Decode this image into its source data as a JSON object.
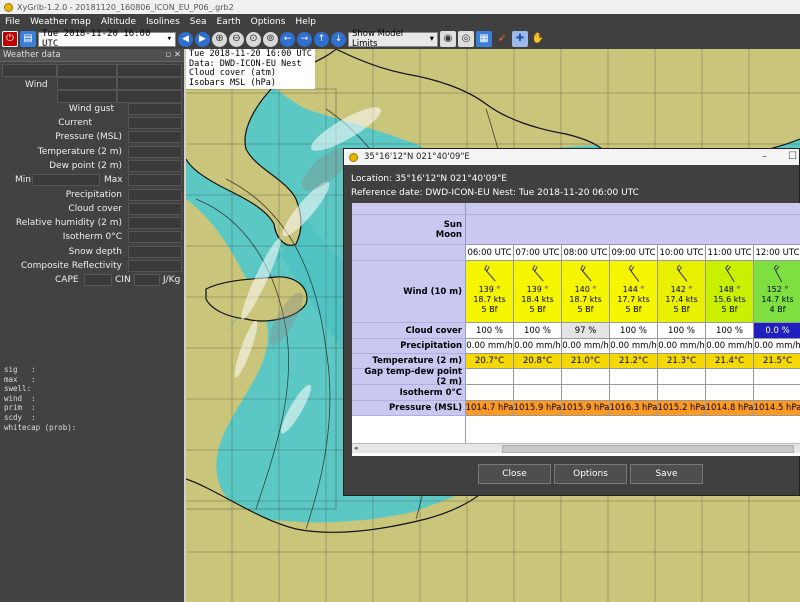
{
  "window": {
    "title": "XyGrib-1.2.0 - 20181120_160806_ICON_EU_P06_.grb2"
  },
  "menu": [
    "File",
    "Weather map",
    "Altitude",
    "Isolines",
    "Sea",
    "Earth",
    "Options",
    "Help"
  ],
  "toolbar": {
    "date_value": "Tue 2018-11-20 16:00 UTC",
    "limits_value": "Show Model Limits",
    "icons": [
      "power-icon",
      "open-file-icon",
      "prev-icon",
      "next-icon",
      "zoom-icons",
      "nav-icons",
      "globe-icons",
      "rocket-icon",
      "crosshair-icon",
      "hand-icon"
    ]
  },
  "panel": {
    "title": "Weather data",
    "wind": "Wind",
    "wind_gust": "Wind gust",
    "current": "Current",
    "pressure": "Pressure (MSL)",
    "temperature": "Temperature (2 m)",
    "dew_point": "Dew point (2 m)",
    "min": "Min",
    "max": "Max",
    "precipitation": "Precipitation",
    "cloud_cover": "Cloud cover",
    "humidity": "Relative humidity (2 m)",
    "isotherm": "Isotherm 0°C",
    "snow_depth": "Snow depth",
    "reflectivity": "Composite Reflectivity",
    "cape": "CAPE",
    "cin": "CIN",
    "jkg": "J/Kg",
    "text_info": "sig   :\nmax   :\nswell:\nwind  :\nprim  :\nscdy  :\nwhitecap (prob):"
  },
  "map_info": {
    "line1": "Tue 2018-11-20 16:00 UTC",
    "line2": "Data: DWD-ICON-EU Nest",
    "line3": "Cloud cover (atm)",
    "line4": "Isobars MSL (hPa)"
  },
  "dialog": {
    "title": "35°16'12\"N 021°40'09\"E",
    "location": "Location:  35°16'12\"N  021°40'09\"E",
    "reference": "Reference date: DWD-ICON-EU Nest: Tue 2018-11-20 06:00 UTC",
    "row_labels": {
      "sun": "Sun",
      "moon": "Moon",
      "wind": "Wind (10 m)",
      "cloud": "Cloud cover",
      "precip": "Precipitation",
      "temp": "Temperature (2 m)",
      "gap": "Gap temp-dew point (2 m)",
      "isotherm": "Isotherm 0°C",
      "pressure": "Pressure (MSL)"
    },
    "times": [
      "06:00 UTC",
      "07:00 UTC",
      "08:00 UTC",
      "09:00 UTC",
      "10:00 UTC",
      "11:00 UTC",
      "12:00 UTC"
    ],
    "wind_dir": [
      "139 °",
      "139 °",
      "140 °",
      "144 °",
      "142 °",
      "148 °",
      "152 °"
    ],
    "wind_kts": [
      "18.7  kts",
      "18.4  kts",
      "18.7  kts",
      "17.7  kts",
      "17.4  kts",
      "15.6  kts",
      "14.7  kts"
    ],
    "wind_bf": [
      "5 Bf",
      "5 Bf",
      "5 Bf",
      "5 Bf",
      "5 Bf",
      "5 Bf",
      "4 Bf"
    ],
    "wind_colors": [
      "#f5f500",
      "#f5f500",
      "#f5f500",
      "#f5f500",
      "#e8f000",
      "#c8f000",
      "#7ee040"
    ],
    "cloud": [
      "100 %",
      "100 %",
      "97 %",
      "100 %",
      "100 %",
      "100 %",
      "0.0 %"
    ],
    "cloud_colors": [
      "#ffffff",
      "#ffffff",
      "#e4e4e4",
      "#ffffff",
      "#ffffff",
      "#ffffff",
      "#2020c0"
    ],
    "precip": [
      "0.00 mm/h",
      "0.00 mm/h",
      "0.00 mm/h",
      "0.00 mm/h",
      "0.00 mm/h",
      "0.00 mm/h",
      "0.00 mm/h"
    ],
    "temp": [
      "20.7°C",
      "20.8°C",
      "21.0°C",
      "21.2°C",
      "21.3°C",
      "21.4°C",
      "21.5°C"
    ],
    "pressure": [
      "1014.7 hPa",
      "1015.9 hPa",
      "1015.9 hPa",
      "1016.3 hPa",
      "1015.2 hPa",
      "1014.8 hPa",
      "1014.5 hPa"
    ],
    "buttons": {
      "close": "Close",
      "options": "Options",
      "save": "Save"
    }
  }
}
